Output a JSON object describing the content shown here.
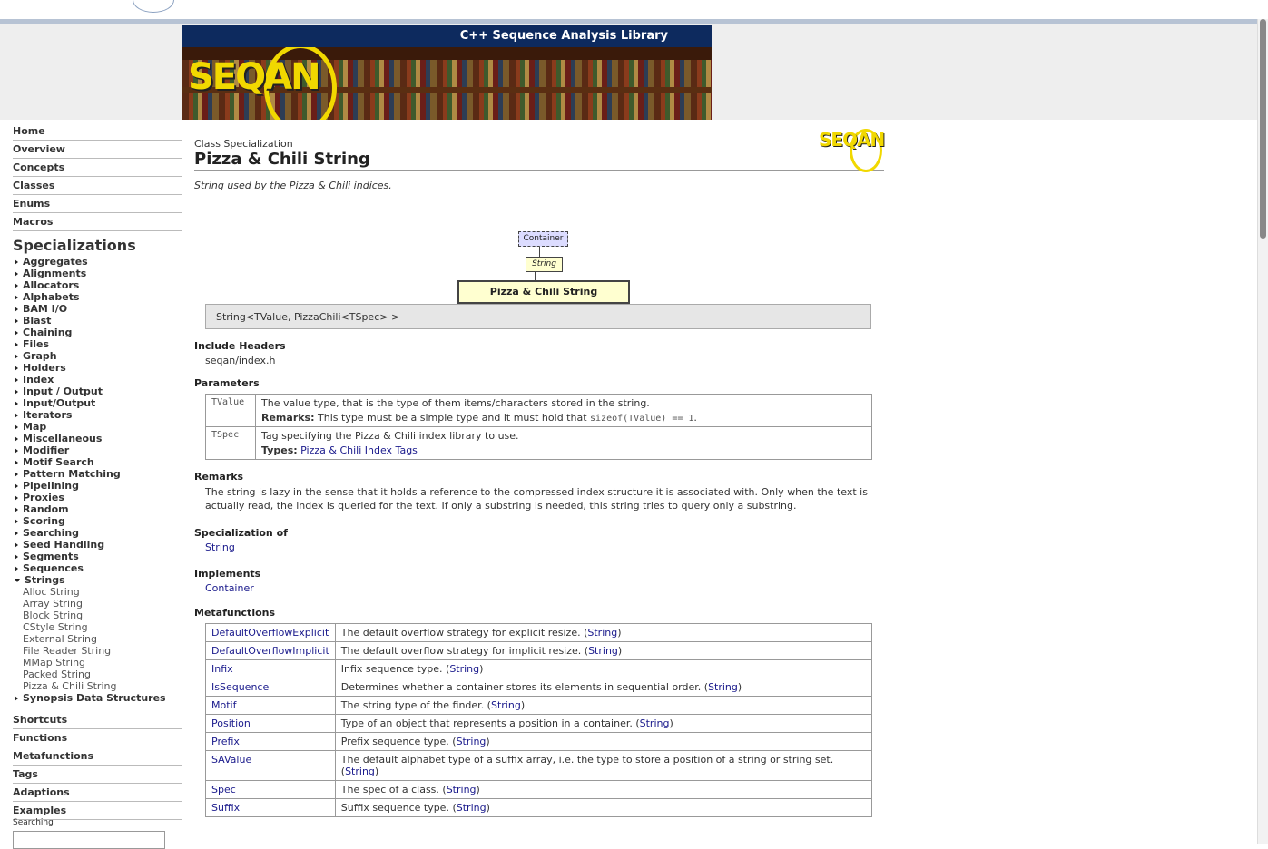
{
  "header": {
    "banner_title": "C++ Sequence Analysis Library",
    "logo_text": "SEQAN"
  },
  "nav": {
    "top": [
      "Home",
      "Overview",
      "Concepts",
      "Classes",
      "Enums",
      "Macros"
    ],
    "specializations_heading": "Specializations",
    "categories": [
      "Aggregates",
      "Alignments",
      "Allocators",
      "Alphabets",
      "BAM I/O",
      "Blast",
      "Chaining",
      "Files",
      "Graph",
      "Holders",
      "Index",
      "Input / Output",
      "Input/Output",
      "Iterators",
      "Map",
      "Miscellaneous",
      "Modifier",
      "Motif Search",
      "Pattern Matching",
      "Pipelining",
      "Proxies",
      "Random",
      "Scoring",
      "Searching",
      "Seed Handling",
      "Segments",
      "Sequences"
    ],
    "open_category": "Strings",
    "string_items": [
      "Alloc String",
      "Array String",
      "Block String",
      "CStyle String",
      "External String",
      "File Reader String",
      "MMap String",
      "Packed String",
      "Pizza & Chili String"
    ],
    "after_category": "Synopsis Data Structures",
    "bottom": [
      "Shortcuts",
      "Functions",
      "Metafunctions",
      "Tags",
      "Adaptions",
      "Examples"
    ],
    "search_label": "Searching"
  },
  "page": {
    "kind": "Class Specialization",
    "title": "Pizza & Chili String",
    "summary": "String used by the Pizza & Chili indices.",
    "diagram": {
      "container": "Container",
      "string": "String",
      "self": "Pizza & Chili String"
    },
    "signature": "String<TValue, PizzaChili<TSpec> >",
    "include_h": "Include Headers",
    "include": "seqan/index.h",
    "params_h": "Parameters",
    "params": [
      {
        "name": "TValue",
        "desc": "The value type, that is the type of them items/characters stored in the string.",
        "extra_label": "Remarks:",
        "extra_text": "This type must be a simple type and it must hold that ",
        "extra_code": "sizeof(TValue) == 1",
        "extra_tail": "."
      },
      {
        "name": "TSpec",
        "desc": "Tag specifying the Pizza & Chili index library to use.",
        "extra_label": "Types:",
        "extra_link": "Pizza & Chili Index Tags"
      }
    ],
    "remarks_h": "Remarks",
    "remarks": "The string is lazy in the sense that it holds a reference to the compressed index structure it is associated with. Only when the text is actually read, the index is queried for the text. If only a substring is needed, this string tries to query only a substring.",
    "specof_h": "Specialization of",
    "specof": "String",
    "impl_h": "Implements",
    "impl": "Container",
    "mf_h": "Metafunctions",
    "metafunctions": [
      {
        "name": "DefaultOverflowExplicit",
        "desc": "The default overflow strategy for explicit resize.",
        "ref": "String"
      },
      {
        "name": "DefaultOverflowImplicit",
        "desc": "The default overflow strategy for implicit resize.",
        "ref": "String"
      },
      {
        "name": "Infix",
        "desc": "Infix sequence type.",
        "ref": "String"
      },
      {
        "name": "IsSequence",
        "desc": "Determines whether a container stores its elements in sequential order.",
        "ref": "String"
      },
      {
        "name": "Motif",
        "desc": "The string type of the finder.",
        "ref": "String"
      },
      {
        "name": "Position",
        "desc": "Type of an object that represents a position in a container.",
        "ref": "String"
      },
      {
        "name": "Prefix",
        "desc": "Prefix sequence type.",
        "ref": "String"
      },
      {
        "name": "SAValue",
        "desc": "The default alphabet type of a suffix array, i.e. the type to store a position of a string or string set.",
        "ref": "String"
      },
      {
        "name": "Spec",
        "desc": "The spec of a class.",
        "ref": "String"
      },
      {
        "name": "Suffix",
        "desc": "Suffix sequence type.",
        "ref": "String"
      }
    ]
  }
}
